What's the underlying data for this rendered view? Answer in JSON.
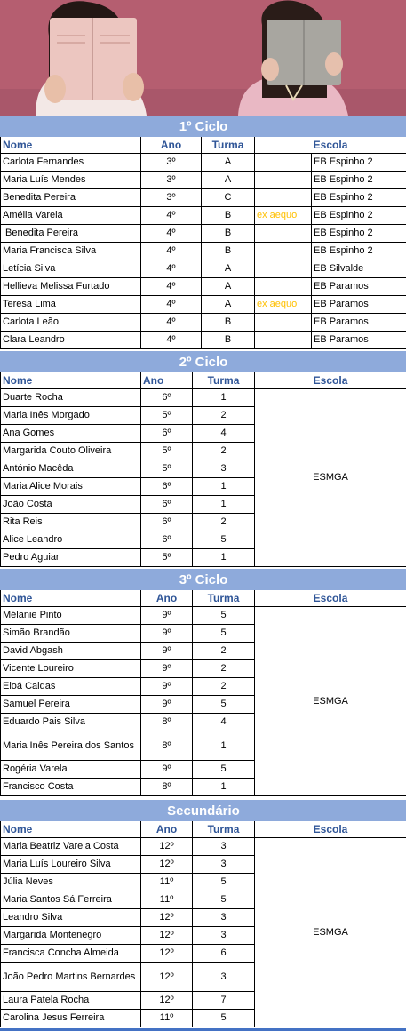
{
  "colors": {
    "band": "#8eaadb",
    "header_text": "#2f5597",
    "note_text": "#ffc000",
    "hero_bg": "#b45a6c"
  },
  "headers": {
    "nome": "Nome",
    "ano": "Ano",
    "turma": "Turma",
    "escola": "Escola"
  },
  "ciclo1": {
    "title": "1º Ciclo",
    "rows": [
      {
        "nome": "Carlota Fernandes",
        "ano": "3º",
        "turma": "A",
        "note": "",
        "escola": "EB Espinho 2"
      },
      {
        "nome": "Maria Luís Mendes",
        "ano": "3º",
        "turma": "A",
        "note": "",
        "escola": "EB Espinho 2"
      },
      {
        "nome": "Benedita Pereira",
        "ano": "3º",
        "turma": "C",
        "note": "",
        "escola": "EB Espinho 2"
      },
      {
        "nome": "Amélia Varela",
        "ano": "4º",
        "turma": "B",
        "note": "ex aequo",
        "escola": "EB Espinho 2"
      },
      {
        "nome": " Benedita Pereira",
        "ano": "4º",
        "turma": "B",
        "note": "",
        "escola": "EB Espinho 2"
      },
      {
        "nome": "Maria Francisca Silva",
        "ano": "4º",
        "turma": "B",
        "note": "",
        "escola": "EB Espinho 2"
      },
      {
        "nome": "Letícia Silva",
        "ano": "4º",
        "turma": "A",
        "note": "",
        "escola": "EB Silvalde"
      },
      {
        "nome": "Hellieva Melissa Furtado",
        "ano": "4º",
        "turma": "A",
        "note": "",
        "escola": "EB Paramos"
      },
      {
        "nome": "Teresa Lima",
        "ano": "4º",
        "turma": "A",
        "note": "ex aequo",
        "escola": "EB Paramos"
      },
      {
        "nome": "Carlota Leão",
        "ano": "4º",
        "turma": "B",
        "note": "",
        "escola": "EB Paramos"
      },
      {
        "nome": "Clara Leandro",
        "ano": "4º",
        "turma": "B",
        "note": "",
        "escola": "EB Paramos"
      }
    ]
  },
  "ciclo2": {
    "title": "2º Ciclo",
    "escola": "ESMGA",
    "rows": [
      {
        "nome": "Duarte Rocha",
        "ano": "6º",
        "turma": "1"
      },
      {
        "nome": "Maria Inês Morgado",
        "ano": "5º",
        "turma": "2"
      },
      {
        "nome": "Ana Gomes",
        "ano": "6º",
        "turma": "4"
      },
      {
        "nome": "Margarida Couto Oliveira",
        "ano": "5º",
        "turma": "2"
      },
      {
        "nome": "António Macêda",
        "ano": "5º",
        "turma": "3"
      },
      {
        "nome": "Maria Alice Morais",
        "ano": "6º",
        "turma": "1"
      },
      {
        "nome": "João Costa",
        "ano": "6º",
        "turma": "1"
      },
      {
        "nome": "Rita Reis",
        "ano": "6º",
        "turma": "2"
      },
      {
        "nome": "Alice Leandro",
        "ano": "6º",
        "turma": "5"
      },
      {
        "nome": "Pedro Aguiar",
        "ano": "5º",
        "turma": "1"
      }
    ]
  },
  "ciclo3": {
    "title": "3º Ciclo",
    "escola": "ESMGA",
    "rows": [
      {
        "nome": "Mélanie Pinto",
        "ano": "9º",
        "turma": "5"
      },
      {
        "nome": "Simão Brandão",
        "ano": "9º",
        "turma": "5"
      },
      {
        "nome": "David Abgash",
        "ano": "9º",
        "turma": "2"
      },
      {
        "nome": "Vicente Loureiro",
        "ano": "9º",
        "turma": "2"
      },
      {
        "nome": "Eloá Caldas",
        "ano": "9º",
        "turma": "2"
      },
      {
        "nome": "Samuel Pereira",
        "ano": "9º",
        "turma": "5"
      },
      {
        "nome": "Eduardo Pais Silva",
        "ano": "8º",
        "turma": "4"
      },
      {
        "nome": "Maria Inês Pereira dos Santos",
        "ano": "8º",
        "turma": "1"
      },
      {
        "nome": "Rogéria Varela",
        "ano": "9º",
        "turma": "5"
      },
      {
        "nome": "Francisco Costa",
        "ano": "8º",
        "turma": "1"
      }
    ]
  },
  "secundario": {
    "title": "Secundário",
    "escola": "ESMGA",
    "rows": [
      {
        "nome": "Maria Beatriz Varela Costa",
        "ano": "12º",
        "turma": "3"
      },
      {
        "nome": "Maria Luís Loureiro Silva",
        "ano": "12º",
        "turma": "3"
      },
      {
        "nome": "Júlia Neves",
        "ano": "11º",
        "turma": "5"
      },
      {
        "nome": "Maria Santos Sá Ferreira",
        "ano": "11º",
        "turma": "5"
      },
      {
        "nome": "Leandro Silva",
        "ano": "12º",
        "turma": "3"
      },
      {
        "nome": "Margarida Montenegro",
        "ano": "12º",
        "turma": "3"
      },
      {
        "nome": "Francisca Concha Almeida",
        "ano": "12º",
        "turma": "6"
      },
      {
        "nome": "João Pedro Martins Bernardes",
        "ano": "12º",
        "turma": "3"
      },
      {
        "nome": "Laura Patela Rocha",
        "ano": "12º",
        "turma": "7"
      },
      {
        "nome": "Carolina Jesus Ferreira",
        "ano": "11º",
        "turma": "5"
      }
    ]
  }
}
